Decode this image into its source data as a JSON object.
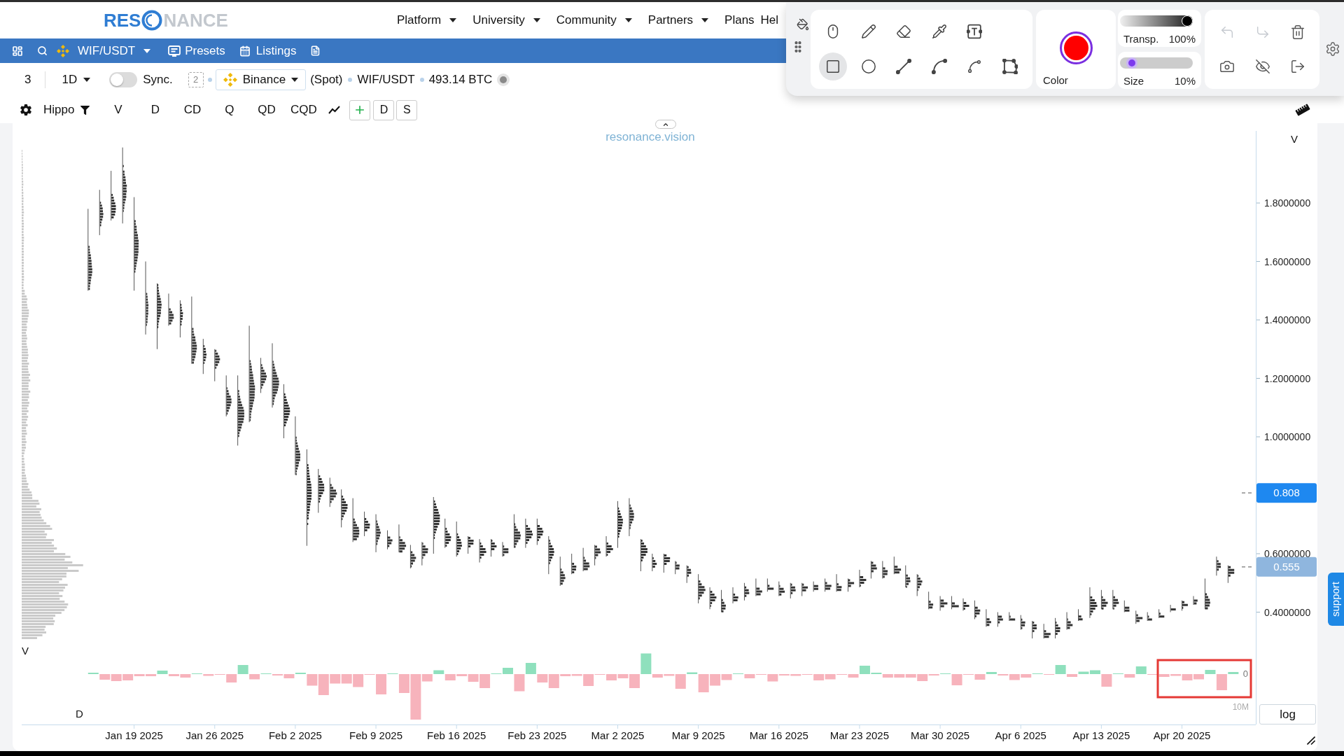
{
  "header": {
    "logo": {
      "left": "RES",
      "right": "NANCE"
    },
    "nav": [
      {
        "label": "Platform",
        "dropdown": true
      },
      {
        "label": "University",
        "dropdown": true
      },
      {
        "label": "Community",
        "dropdown": true
      },
      {
        "label": "Partners",
        "dropdown": true
      },
      {
        "label": "Plans",
        "dropdown": false
      },
      {
        "label": "Hel",
        "dropdown": false
      }
    ]
  },
  "symbol_bar": {
    "symbol": "WIF/USDT",
    "links": [
      {
        "kind": "presets",
        "label": "Presets"
      },
      {
        "kind": "listings",
        "label": "Listings"
      }
    ]
  },
  "chart_header": {
    "chart_number": "3",
    "interval": "1D",
    "sync": {
      "label": "Sync.",
      "on": false
    },
    "link_group": "2",
    "exchange": "Binance",
    "market": "(Spot)",
    "pair": "WIF/USDT",
    "volume": "493.14 BTC"
  },
  "indicator_bar": {
    "preset": "Hippo",
    "indicators": [
      "V",
      "D",
      "CD",
      "Q",
      "QD",
      "CQD"
    ],
    "buttons": [
      "D",
      "S"
    ]
  },
  "drawing_toolbar": {
    "tool_rows": [
      [
        {
          "kind": "mouse",
          "selected": false
        },
        {
          "kind": "pencil",
          "selected": false
        },
        {
          "kind": "eraser",
          "selected": false
        },
        {
          "kind": "eyedropper",
          "selected": false
        },
        {
          "kind": "text",
          "selected": false
        }
      ],
      [
        {
          "kind": "rectangle",
          "selected": true
        },
        {
          "kind": "circle",
          "selected": false
        },
        {
          "kind": "line",
          "selected": false
        },
        {
          "kind": "arc",
          "selected": false
        },
        {
          "kind": "curve",
          "selected": false
        },
        {
          "kind": "polygon",
          "selected": false
        }
      ]
    ],
    "color": {
      "label": "Color",
      "color": "#ff0000"
    },
    "transparency": {
      "label": "Transp.",
      "reading": "100%",
      "level": 1
    },
    "size": {
      "label": "Size",
      "reading": "10%",
      "level": 0.1
    },
    "actions": [
      {
        "kind": "undo",
        "disabled": true
      },
      {
        "kind": "redo",
        "disabled": true
      },
      {
        "kind": "delete",
        "disabled": false
      },
      {
        "kind": "screenshot",
        "disabled": false
      },
      {
        "kind": "hide",
        "disabled": false
      },
      {
        "kind": "export",
        "disabled": false
      }
    ]
  },
  "chart": {
    "watermark": "resonance.vision",
    "profile_label": "V",
    "delta_label": "D",
    "delta_zero": "0",
    "delta_scale": "10M",
    "price_axis": {
      "title": "V",
      "labels": [
        "1.8000000",
        "1.6000000",
        "1.4000000",
        "1.2000000",
        "1.0000000",
        "0.6000000",
        "0.4000000"
      ],
      "markers": [
        {
          "kind": "last",
          "label": "0.808"
        },
        {
          "kind": "current",
          "label": "0.555"
        }
      ]
    },
    "date_labels": [
      "Jan 19 2025",
      "Jan 26 2025",
      "Feb 2 2025",
      "Feb 9 2025",
      "Feb 16 2025",
      "Feb 23 2025",
      "Mar 2 2025",
      "Mar 9 2025",
      "Mar 16 2025",
      "Mar 23 2025",
      "Mar 30 2025",
      "Apr 6 2025",
      "Apr 13 2025",
      "Apr 20 2025"
    ],
    "scale_button": "log"
  },
  "support_tab": "support"
}
